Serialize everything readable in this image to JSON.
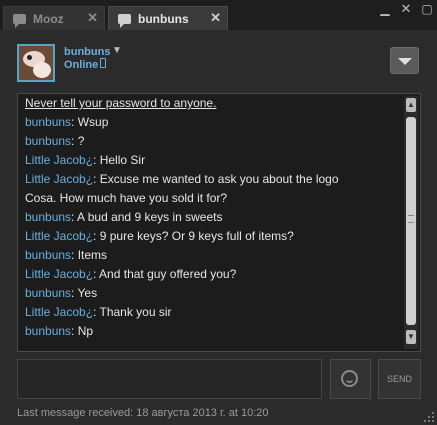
{
  "tabs": [
    {
      "label": "Mooz",
      "close": "✕"
    },
    {
      "label": "bunbuns",
      "close": "✕"
    }
  ],
  "window_controls": {
    "minimize": "▁",
    "close": "✕",
    "maximize": "▢"
  },
  "header": {
    "username": "bunbuns",
    "username_caret": "▼",
    "status": "Online"
  },
  "chat": {
    "warning": "Never tell your password to anyone.",
    "messages": [
      {
        "sender": "bunbuns",
        "text": ": Wsup"
      },
      {
        "sender": "bunbuns",
        "text": ": ?"
      },
      {
        "sender": "Little Jacob¿",
        "text": ": Hello Sir"
      },
      {
        "sender": "Little Jacob¿",
        "text": ": Excuse me wanted to ask you about the logo"
      },
      {
        "sender": "",
        "text": "Cosa. How much have you sold it for?"
      },
      {
        "sender": "bunbuns",
        "text": ": A bud and 9 keys in sweets"
      },
      {
        "sender": "Little Jacob¿",
        "text": ": 9 pure keys? Or 9 keys full of items?"
      },
      {
        "sender": "bunbuns",
        "text": ": Items"
      },
      {
        "sender": "Little Jacob¿",
        "text": ": And that guy offered you?"
      },
      {
        "sender": "bunbuns",
        "text": ": Yes"
      },
      {
        "sender": "Little Jacob¿",
        "text": ": Thank you sir"
      },
      {
        "sender": "bunbuns",
        "text": ": Np"
      }
    ]
  },
  "scrollbar": {
    "up": "▲",
    "down": "▼"
  },
  "composer": {
    "input_value": "",
    "input_placeholder": "",
    "send_label": "SEND"
  },
  "footer": {
    "text": "Last message received: 18 августа 2013 г. at 10:20"
  },
  "colors": {
    "accent": "#69b0e0",
    "background": "#2b2b2b",
    "log_background": "#1c1c1c"
  },
  "icons": [
    "chat-bubble-icon",
    "phone-icon",
    "dropdown-arrow-icon",
    "emoticon-icon",
    "resize-grip-icon"
  ]
}
